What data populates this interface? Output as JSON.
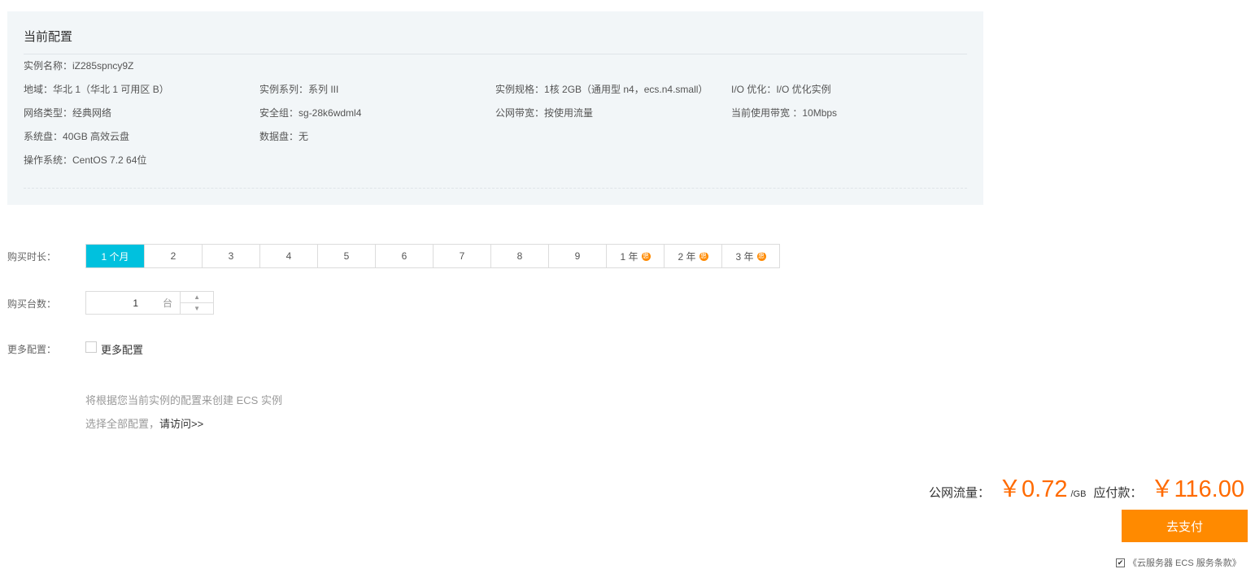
{
  "config": {
    "title": "当前配置",
    "instance_name_label": "实例名称：",
    "instance_name": "iZ285spncy9Z",
    "region_label": "地域：",
    "region": "华北 1（华北 1 可用区 B）",
    "series_label": "实例系列：",
    "series": "系列 III",
    "spec_label": "实例规格：",
    "spec": "1核 2GB（通用型 n4，ecs.n4.small）",
    "io_label": "I/O 优化：",
    "io": "I/O 优化实例",
    "network_label": "网络类型：",
    "network": "经典网络",
    "security_label": "安全组：",
    "security": "sg-28k6wdml4",
    "bandwidth_label": "公网带宽：",
    "bandwidth": "按使用流量",
    "current_bw_label": "当前使用带宽 ：",
    "current_bw": "10Mbps",
    "system_disk_label": "系统盘：",
    "system_disk": "40GB 高效云盘",
    "data_disk_label": "数据盘：",
    "data_disk": "无",
    "os_label": "操作系统：",
    "os": "CentOS 7.2 64位"
  },
  "duration": {
    "label": "购买时长：",
    "options": [
      "1 个月",
      "2",
      "3",
      "4",
      "5",
      "6",
      "7",
      "8",
      "9",
      "1 年",
      "2 年",
      "3 年"
    ],
    "discount_badge": "惠",
    "selected": "1 个月"
  },
  "quantity": {
    "label": "购买台数：",
    "value": "1",
    "unit": "台"
  },
  "more": {
    "label": "更多配置：",
    "checkbox_label": "更多配置",
    "hint1": "将根据您当前实例的配置来创建 ECS 实例",
    "hint2_prefix": "选择全部配置，",
    "hint2_link": "请访问>>"
  },
  "price": {
    "traffic_label": "公网流量：",
    "traffic_amount": "￥0.72",
    "traffic_unit": "/GB",
    "total_label": "应付款：",
    "total_amount": "￥116.00"
  },
  "pay_button": "去支付",
  "terms": "《云服务器 ECS 服务条款》",
  "colors": {
    "accent": "#00c1de",
    "price": "#ff6a00",
    "pay_button": "#ff8a00",
    "badge": "#ff8a00"
  }
}
